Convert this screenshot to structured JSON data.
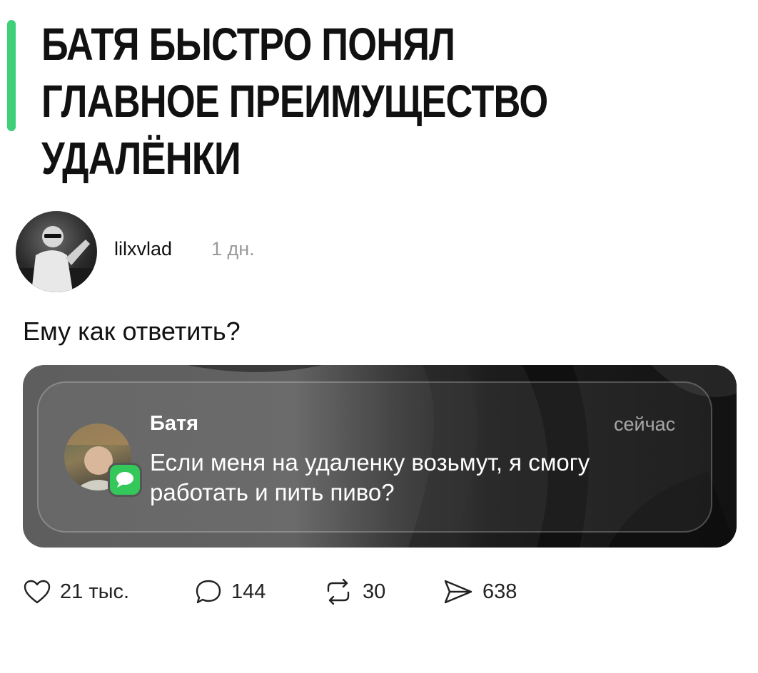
{
  "header": {
    "headline": "БАТЯ БЫСТРО ПОНЯЛ ГЛАВНОЕ ПРЕИМУЩЕСТВО УДАЛЁНКИ",
    "accent_color": "#3fd07a"
  },
  "post": {
    "username": "lilxvlad",
    "time": "1 дн.",
    "text": "Ему как ответить?"
  },
  "notification": {
    "sender": "Батя",
    "time": "сейчас",
    "message": "Если меня на удаленку возьмут, я смогу работать и пить пиво?",
    "app_icon": "messages-icon",
    "badge_color": "#34c759"
  },
  "actions": {
    "likes": "21 тыс.",
    "comments": "144",
    "reposts": "30",
    "shares": "638"
  }
}
